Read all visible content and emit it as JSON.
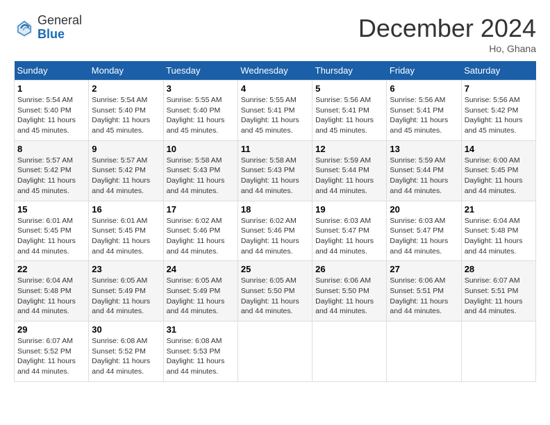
{
  "header": {
    "logo_general": "General",
    "logo_blue": "Blue",
    "title": "December 2024",
    "location": "Ho, Ghana"
  },
  "days_of_week": [
    "Sunday",
    "Monday",
    "Tuesday",
    "Wednesday",
    "Thursday",
    "Friday",
    "Saturday"
  ],
  "weeks": [
    [
      {
        "day": "1",
        "info": "Sunrise: 5:54 AM\nSunset: 5:40 PM\nDaylight: 11 hours and 45 minutes."
      },
      {
        "day": "2",
        "info": "Sunrise: 5:54 AM\nSunset: 5:40 PM\nDaylight: 11 hours and 45 minutes."
      },
      {
        "day": "3",
        "info": "Sunrise: 5:55 AM\nSunset: 5:40 PM\nDaylight: 11 hours and 45 minutes."
      },
      {
        "day": "4",
        "info": "Sunrise: 5:55 AM\nSunset: 5:41 PM\nDaylight: 11 hours and 45 minutes."
      },
      {
        "day": "5",
        "info": "Sunrise: 5:56 AM\nSunset: 5:41 PM\nDaylight: 11 hours and 45 minutes."
      },
      {
        "day": "6",
        "info": "Sunrise: 5:56 AM\nSunset: 5:41 PM\nDaylight: 11 hours and 45 minutes."
      },
      {
        "day": "7",
        "info": "Sunrise: 5:56 AM\nSunset: 5:42 PM\nDaylight: 11 hours and 45 minutes."
      }
    ],
    [
      {
        "day": "8",
        "info": "Sunrise: 5:57 AM\nSunset: 5:42 PM\nDaylight: 11 hours and 45 minutes."
      },
      {
        "day": "9",
        "info": "Sunrise: 5:57 AM\nSunset: 5:42 PM\nDaylight: 11 hours and 44 minutes."
      },
      {
        "day": "10",
        "info": "Sunrise: 5:58 AM\nSunset: 5:43 PM\nDaylight: 11 hours and 44 minutes."
      },
      {
        "day": "11",
        "info": "Sunrise: 5:58 AM\nSunset: 5:43 PM\nDaylight: 11 hours and 44 minutes."
      },
      {
        "day": "12",
        "info": "Sunrise: 5:59 AM\nSunset: 5:44 PM\nDaylight: 11 hours and 44 minutes."
      },
      {
        "day": "13",
        "info": "Sunrise: 5:59 AM\nSunset: 5:44 PM\nDaylight: 11 hours and 44 minutes."
      },
      {
        "day": "14",
        "info": "Sunrise: 6:00 AM\nSunset: 5:45 PM\nDaylight: 11 hours and 44 minutes."
      }
    ],
    [
      {
        "day": "15",
        "info": "Sunrise: 6:01 AM\nSunset: 5:45 PM\nDaylight: 11 hours and 44 minutes."
      },
      {
        "day": "16",
        "info": "Sunrise: 6:01 AM\nSunset: 5:45 PM\nDaylight: 11 hours and 44 minutes."
      },
      {
        "day": "17",
        "info": "Sunrise: 6:02 AM\nSunset: 5:46 PM\nDaylight: 11 hours and 44 minutes."
      },
      {
        "day": "18",
        "info": "Sunrise: 6:02 AM\nSunset: 5:46 PM\nDaylight: 11 hours and 44 minutes."
      },
      {
        "day": "19",
        "info": "Sunrise: 6:03 AM\nSunset: 5:47 PM\nDaylight: 11 hours and 44 minutes."
      },
      {
        "day": "20",
        "info": "Sunrise: 6:03 AM\nSunset: 5:47 PM\nDaylight: 11 hours and 44 minutes."
      },
      {
        "day": "21",
        "info": "Sunrise: 6:04 AM\nSunset: 5:48 PM\nDaylight: 11 hours and 44 minutes."
      }
    ],
    [
      {
        "day": "22",
        "info": "Sunrise: 6:04 AM\nSunset: 5:48 PM\nDaylight: 11 hours and 44 minutes."
      },
      {
        "day": "23",
        "info": "Sunrise: 6:05 AM\nSunset: 5:49 PM\nDaylight: 11 hours and 44 minutes."
      },
      {
        "day": "24",
        "info": "Sunrise: 6:05 AM\nSunset: 5:49 PM\nDaylight: 11 hours and 44 minutes."
      },
      {
        "day": "25",
        "info": "Sunrise: 6:05 AM\nSunset: 5:50 PM\nDaylight: 11 hours and 44 minutes."
      },
      {
        "day": "26",
        "info": "Sunrise: 6:06 AM\nSunset: 5:50 PM\nDaylight: 11 hours and 44 minutes."
      },
      {
        "day": "27",
        "info": "Sunrise: 6:06 AM\nSunset: 5:51 PM\nDaylight: 11 hours and 44 minutes."
      },
      {
        "day": "28",
        "info": "Sunrise: 6:07 AM\nSunset: 5:51 PM\nDaylight: 11 hours and 44 minutes."
      }
    ],
    [
      {
        "day": "29",
        "info": "Sunrise: 6:07 AM\nSunset: 5:52 PM\nDaylight: 11 hours and 44 minutes."
      },
      {
        "day": "30",
        "info": "Sunrise: 6:08 AM\nSunset: 5:52 PM\nDaylight: 11 hours and 44 minutes."
      },
      {
        "day": "31",
        "info": "Sunrise: 6:08 AM\nSunset: 5:53 PM\nDaylight: 11 hours and 44 minutes."
      },
      {
        "day": "",
        "info": ""
      },
      {
        "day": "",
        "info": ""
      },
      {
        "day": "",
        "info": ""
      },
      {
        "day": "",
        "info": ""
      }
    ]
  ]
}
